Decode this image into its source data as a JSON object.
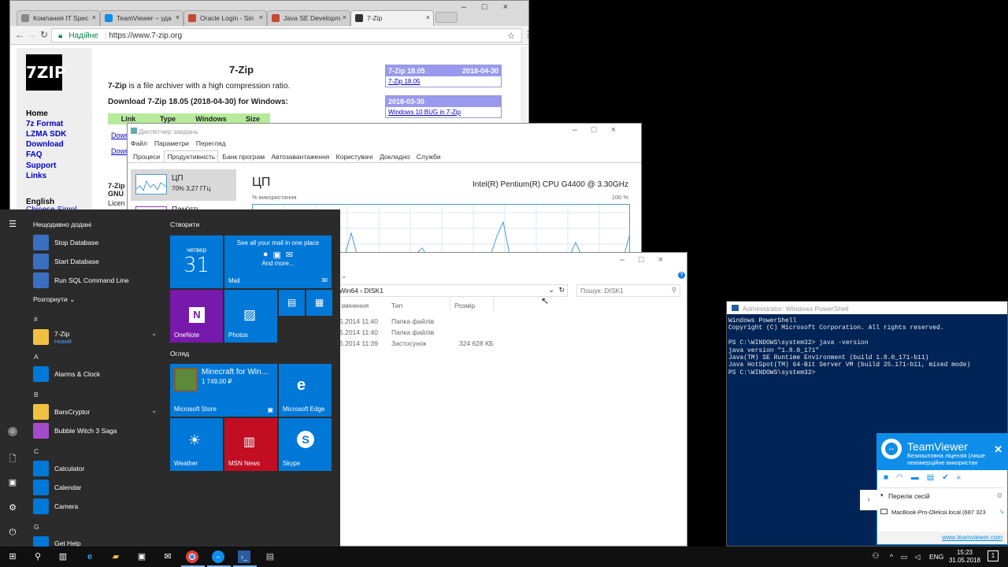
{
  "chrome": {
    "tabs": [
      {
        "label": "Компания IT Spec",
        "color": "#888888"
      },
      {
        "label": "TeamViewer – уда",
        "color": "#0e8ee9"
      },
      {
        "label": "Oracle Login - Sin",
        "color": "#c74634"
      },
      {
        "label": "Java SE Developm",
        "color": "#c74634"
      },
      {
        "label": "7-Zip",
        "color": "#333333"
      }
    ],
    "secure_label": "Надійне",
    "url": "https://www.7-zip.org",
    "page": {
      "title": "7-Zip",
      "intro_bold": "7-Zip",
      "intro_rest": " is a file archiver with a high compression ratio.",
      "download_heading": "Download 7-Zip 18.05 (2018-04-30) for Windows:",
      "table_headers": [
        "Link",
        "Type",
        "Windows",
        "Size"
      ],
      "download_links": [
        "Down",
        "Down"
      ],
      "sidebar_links": [
        "Home",
        "7z Format",
        "LZMA SDK",
        "Download",
        "FAQ",
        "Support",
        "Links"
      ],
      "lang_heading": "English",
      "lang_link": "Chinese Simpl.",
      "partial_text": [
        "7-Zip",
        "GNU",
        "Licen"
      ],
      "news": [
        {
          "title": "7-Zip 18.05",
          "date": "2018-04-30",
          "link": "7-Zip 18.05"
        },
        {
          "title": "2018-03-30",
          "date": "",
          "link": "Windows 10 BUG in 7-Zip"
        }
      ],
      "logo_text": "7ZIP"
    }
  },
  "taskmgr": {
    "title": "Диспетчер завдань",
    "menu": [
      "Файл",
      "Параметри",
      "Перегляд"
    ],
    "tabs": [
      "Процеси",
      "Продуктивність",
      "Банк програм",
      "Автозавантаження",
      "Користувачі",
      "Докладно",
      "Служби"
    ],
    "active_tab": "Продуктивність",
    "cpu_label": "ЦП",
    "cpu_stat": "70% 3,27 ГГц",
    "memory_label": "Пам'ять",
    "heading": "ЦП",
    "cpu_model": "Intel(R) Pentium(R) CPU G4400 @ 3.30GHz",
    "usage_label": "% використання",
    "usage_max": "100 %"
  },
  "explorer": {
    "path": "_Win64 › DISK1",
    "search_placeholder": "Пошук: DISK1",
    "columns": [
      "змінення",
      "Тип",
      "Розмір"
    ],
    "rows": [
      {
        "date": "5.2014 11:40",
        "type": "Папка файлів",
        "size": ""
      },
      {
        "date": "5.2014 11:40",
        "type": "Папка файлів",
        "size": ""
      },
      {
        "date": "5.2014 11:39",
        "type": "Застосунок",
        "size": "324 628 КБ"
      }
    ]
  },
  "start": {
    "recent_heading": "Нещодавно додані",
    "recent": [
      "Stop Database",
      "Start Database",
      "Run SQL Command Line"
    ],
    "expand_label": "Розгорнути",
    "letters": [
      "#",
      "A",
      "B",
      "C",
      "G"
    ],
    "apps": {
      "zip": "7-Zip",
      "zip_sub": "Новий",
      "alarms": "Alarms & Clock",
      "bars": "BarsCryptor",
      "bubble": "Bubble Witch 3 Saga",
      "calculator": "Calculator",
      "calendar": "Calendar",
      "camera": "Camera",
      "gethelp": "Get Help"
    },
    "create_heading": "Створити",
    "browse_heading": "Огляд",
    "tiles": {
      "cal_day": "четвер",
      "cal_date": "31",
      "mail_top": "See all your mail in one place",
      "mail_more": "And more...",
      "mail": "Mail",
      "onenote": "OneNote",
      "photos": "Photos",
      "minecraft": "Minecraft for Win...",
      "minecraft_price": "1 749,00 ₽",
      "store": "Microsoft Store",
      "edge": "Microsoft Edge",
      "weather": "Weather",
      "msn": "MSN News",
      "skype": "Skype"
    }
  },
  "powershell": {
    "title": "Administrator: Windows PowerShell",
    "lines": [
      "Windows PowerShell",
      "Copyright (C) Microsoft Corporation. All rights reserved.",
      "",
      "PS C:\\WINDOWS\\system32> java -version",
      "java version \"1.8.0_171\"",
      "Java(TM) SE Runtime Environment (build 1.8.0_171-b11)",
      "Java HotSpot(TM) 64-Bit Server VM (build 25.171-b11, mixed mode)",
      "PS C:\\WINDOWS\\system32>"
    ]
  },
  "teamviewer": {
    "title": "TeamViewer",
    "license": "Безкоштовна ліцензія (лише некомерційне використан",
    "sessions_label": "Перелік сесій",
    "session": "MacBook-Pro-Oleksii.local (687 323 ",
    "link": "www.teamviewer.com"
  },
  "taskbar": {
    "lang": "ENG",
    "time": "15:23",
    "date": "31.05.2018",
    "notif_count": "1"
  },
  "colors": {
    "start_bg": "#2b2b2b",
    "tile_blue": "#0078d7",
    "onenote": "#7719aa",
    "msn": "#c30d23",
    "ps_bg": "#012456",
    "tv_blue": "#0e8ee9",
    "news_header": "#9999ee"
  }
}
